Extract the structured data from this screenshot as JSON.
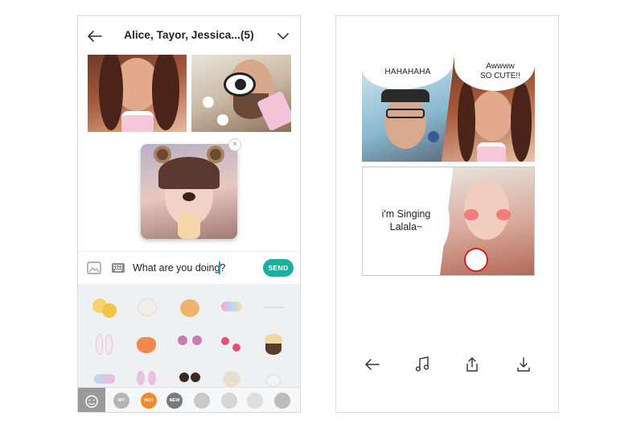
{
  "chat": {
    "title": "Alice, Tayor, Jessica...(5)",
    "message_value": "What are you doing?",
    "send_label": "SEND",
    "self_close": "×"
  },
  "sticker_tabs": [
    {
      "name": "history",
      "label": ""
    },
    {
      "name": "my",
      "label": "MY"
    },
    {
      "name": "hot",
      "label": "HOT",
      "color": "#f08a2a"
    },
    {
      "name": "new",
      "label": "NEW",
      "color": "#7a7a7a"
    },
    {
      "name": "cat",
      "label": ""
    },
    {
      "name": "bunny",
      "label": ""
    },
    {
      "name": "bow",
      "label": ""
    },
    {
      "name": "face",
      "label": ""
    }
  ],
  "comic": {
    "bubble_1": "HAHAHAHA",
    "bubble_2_line1": "Awwww",
    "bubble_2_line2": "SO CUTE!!",
    "bubble_3_line1": "i'm Singing",
    "bubble_3_line2": "Lalala~"
  },
  "colors": {
    "accent": "#1ab0a0",
    "hot_tab": "#f08a2a"
  },
  "icons": {
    "back": "arrow-left-icon",
    "dropdown": "chevron-down-icon",
    "image": "image-icon",
    "keyboard": "keyboard-icon",
    "music": "music-note-icon",
    "share": "share-icon",
    "download": "download-icon"
  }
}
